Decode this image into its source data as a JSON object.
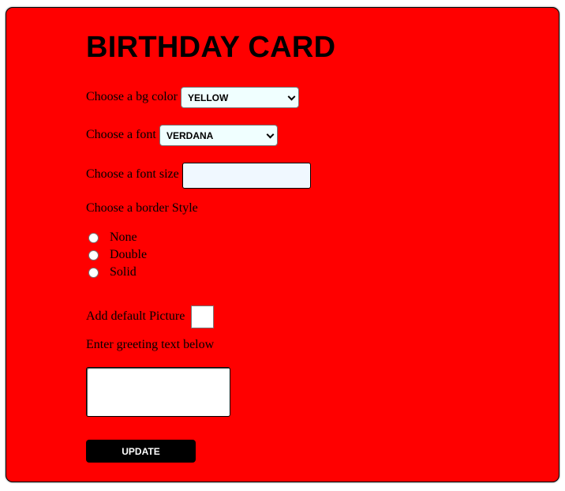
{
  "card": {
    "title": "BIRTHDAY CARD",
    "bg_color": {
      "label": "Choose a bg color",
      "selected": "YELLOW"
    },
    "font": {
      "label": "Choose a font",
      "selected": "VERDANA"
    },
    "font_size": {
      "label": "Choose a font size",
      "value": ""
    },
    "border_style": {
      "label": "Choose a border Style",
      "options": [
        "None",
        "Double",
        "Solid"
      ]
    },
    "default_picture": {
      "label": "Add default Picture",
      "checked": false
    },
    "greeting": {
      "label": "Enter greeting text below",
      "value": ""
    },
    "update_label": "UPDATE"
  },
  "colors": {
    "card_bg": "#ff0000",
    "select_bg": "#f0ffff",
    "input_bg": "#f0f8ff",
    "button_bg": "#000000"
  }
}
